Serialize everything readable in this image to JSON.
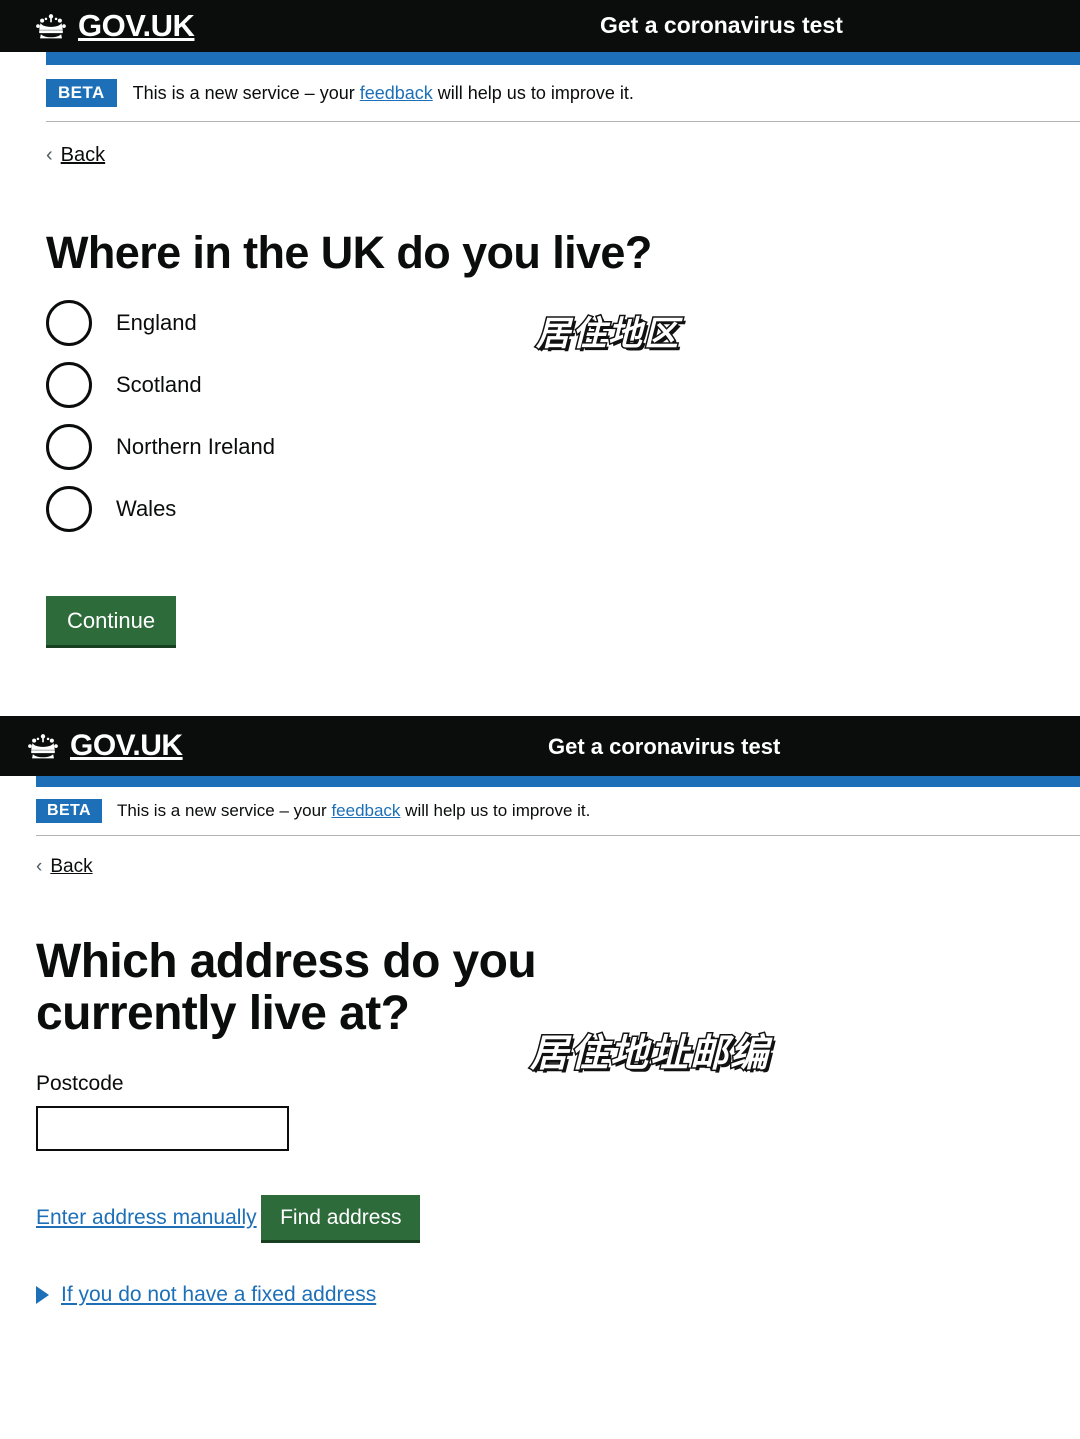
{
  "screen1": {
    "header": {
      "brand": "GOV.UK",
      "crown_icon": "crown-icon",
      "service_name": "Get a coronavirus test"
    },
    "phase_banner": {
      "tag": "BETA",
      "text_before": "This is a new service – your ",
      "link": "feedback",
      "text_after": " will help us to improve it."
    },
    "back": {
      "chevron_icon": "chevron-left-icon",
      "label": "Back"
    },
    "heading": "Where in the UK do you live?",
    "radios": [
      {
        "label": "England",
        "selected": false
      },
      {
        "label": "Scotland",
        "selected": false
      },
      {
        "label": "Northern Ireland",
        "selected": false
      },
      {
        "label": "Wales",
        "selected": false
      }
    ],
    "submit_label": "Continue",
    "annotation": "居住地区"
  },
  "screen2": {
    "header": {
      "brand": "GOV.UK",
      "crown_icon": "crown-icon",
      "service_name": "Get a coronavirus test"
    },
    "phase_banner": {
      "tag": "BETA",
      "text_before": "This is a new service – your ",
      "link": "feedback",
      "text_after": " will help us to improve it."
    },
    "back": {
      "chevron_icon": "chevron-left-icon",
      "label": "Back"
    },
    "heading": "Which address do you currently live at?",
    "postcode": {
      "label": "Postcode",
      "value": "",
      "placeholder": ""
    },
    "manual_link": "Enter address manually",
    "submit_label": "Find address",
    "details": {
      "arrow_icon": "triangle-right-icon",
      "summary": "If you do not have a fixed address"
    },
    "annotation": "居住地址邮编"
  },
  "colors": {
    "header_black": "#0b0c0c",
    "govuk_blue": "#1d70b8",
    "button_green": "#2e6b3b",
    "button_green_shadow": "#16401f",
    "rule_grey": "#b1b4b6"
  }
}
